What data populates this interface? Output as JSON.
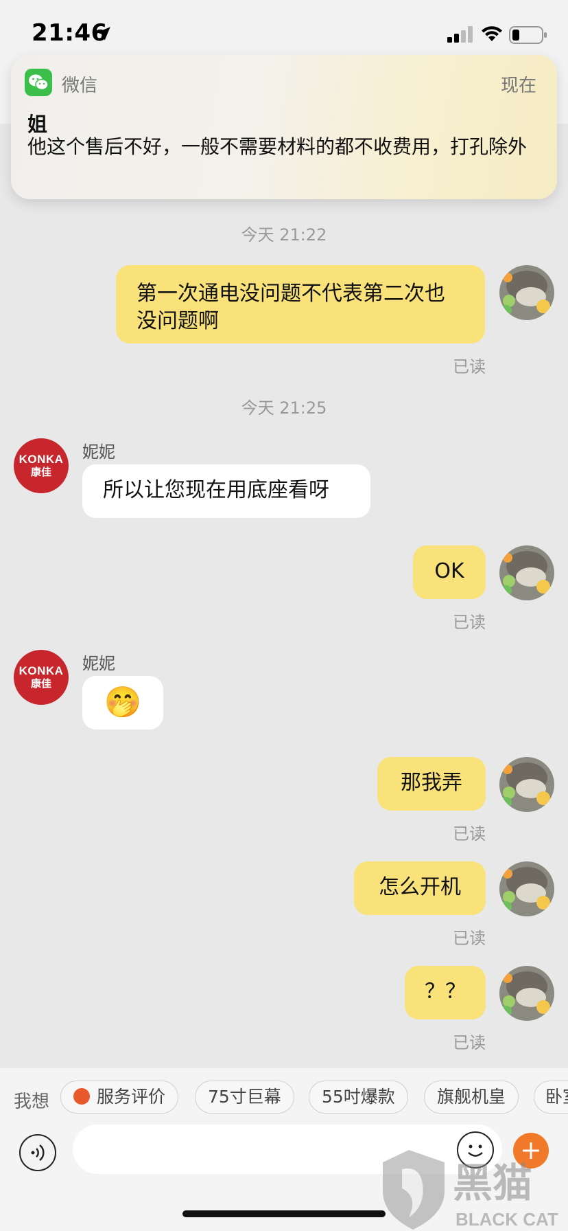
{
  "status_bar": {
    "time": "21:46"
  },
  "notification": {
    "app_name": "微信",
    "time": "现在",
    "title": "姐",
    "body": "他这个售后不好，一般不需要材料的都不收费用，打孔除外"
  },
  "messages": {
    "timestamp_1": "今天 21:22",
    "out_1": "第一次通电没问题不代表第二次也没问题啊",
    "read_1": "已读",
    "timestamp_2": "今天 21:25",
    "sender_1": "妮妮",
    "in_1": "所以让您现在用底座看呀",
    "out_2": "OK",
    "read_2": "已读",
    "sender_2": "妮妮",
    "in_2_emoji": "🤭",
    "out_3": "那我弄",
    "read_3": "已读",
    "out_4": "怎么开机",
    "read_4": "已读",
    "out_5": "？？",
    "read_5": "已读"
  },
  "konka_logo": {
    "latin": "KONKA",
    "chinese": "康佳"
  },
  "quick_replies": {
    "label": "我想",
    "items": [
      "服务评价",
      "75寸巨幕",
      "55吋爆款",
      "旗舰机皇",
      "卧室"
    ]
  },
  "watermark": {
    "chinese": "黑猫",
    "latin": "BLACK CAT"
  },
  "colors": {
    "outgoing_bubble": "#f9e27a",
    "incoming_bubble": "#ffffff",
    "konka_red": "#c6262c",
    "accent_orange": "#f07a2a"
  }
}
